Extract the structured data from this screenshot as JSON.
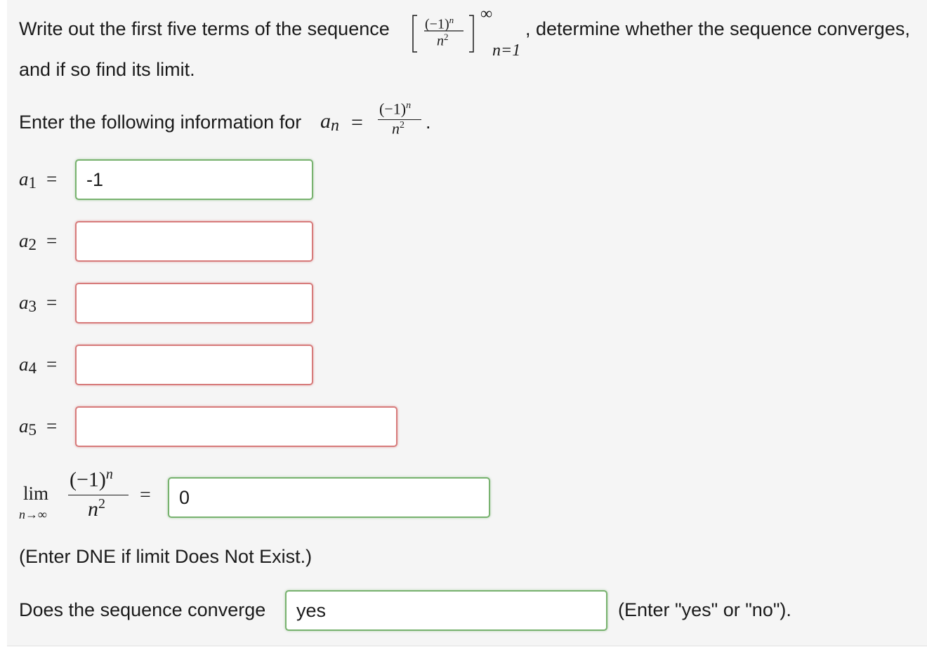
{
  "intro": {
    "line1_before": "Write out the first five terms of the sequence",
    "line1_after": ", determine whether the sequence converges,",
    "line2": "and if so find its limit."
  },
  "sequence_formula": {
    "numerator": "(−1)",
    "numerator_exp": "n",
    "denominator": "n",
    "denominator_exp": "2",
    "upper_index": "∞",
    "lower_index": "n=1"
  },
  "prompt": {
    "text": "Enter the following information for",
    "var": "a",
    "var_sub": "n",
    "equals": "=",
    "period": "."
  },
  "terms": [
    {
      "symbol": "a",
      "index": "1",
      "equals": "=",
      "value": "",
      "status": "correct",
      "display": "-1"
    },
    {
      "symbol": "a",
      "index": "2",
      "equals": "=",
      "value": "",
      "status": "incorrect",
      "display": ""
    },
    {
      "symbol": "a",
      "index": "3",
      "equals": "=",
      "value": "",
      "status": "incorrect",
      "display": ""
    },
    {
      "symbol": "a",
      "index": "4",
      "equals": "=",
      "value": "",
      "status": "incorrect",
      "display": ""
    },
    {
      "symbol": "a",
      "index": "5",
      "equals": "=",
      "value": "",
      "status": "incorrect",
      "display": ""
    }
  ],
  "limit": {
    "lim_label": "lim",
    "lim_sub": "n→∞",
    "equals": "=",
    "value": "0",
    "status": "correct"
  },
  "dne_note": "(Enter DNE if limit Does Not Exist.)",
  "converge": {
    "label": "Does the sequence converge",
    "value": "yes",
    "status": "correct",
    "hint": "(Enter \"yes\" or \"no\")."
  },
  "colors": {
    "correct_border": "#78b26f",
    "incorrect_border": "#d77b7b",
    "panel_bg": "#f5f5f5"
  }
}
